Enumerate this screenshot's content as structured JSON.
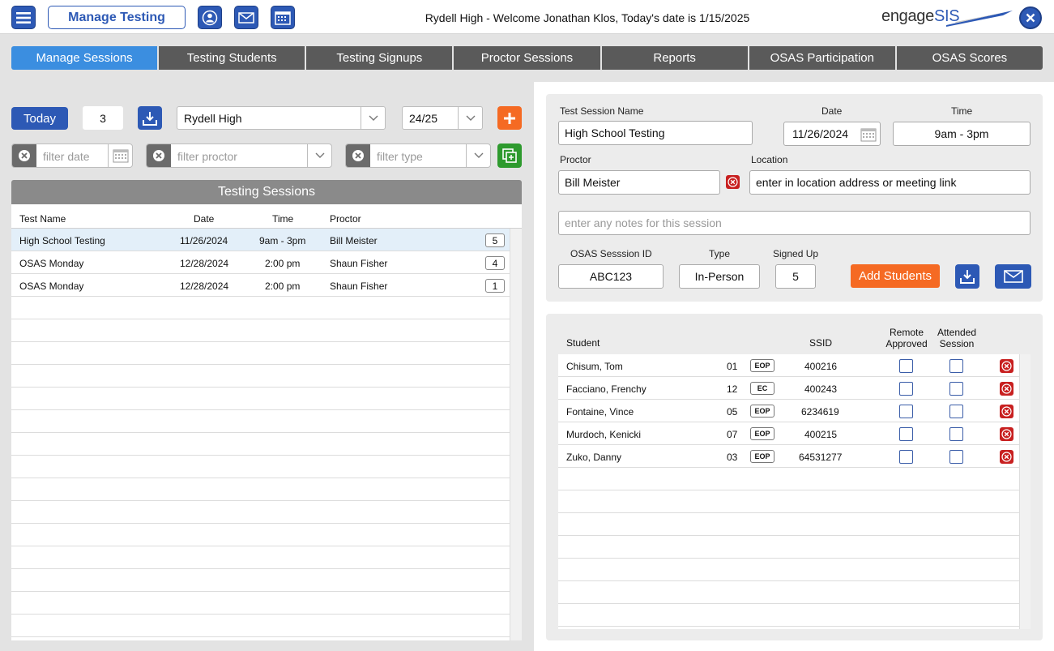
{
  "header": {
    "app_title": "Manage Testing",
    "welcome": "Rydell High - Welcome Jonathan Klos, Today's date is 1/15/2025",
    "logo_main": "engage",
    "logo_accent": "SIS"
  },
  "tabs": [
    {
      "label": "Manage Sessions",
      "active": true
    },
    {
      "label": "Testing Students"
    },
    {
      "label": "Testing Signups"
    },
    {
      "label": "Proctor Sessions"
    },
    {
      "label": "Reports"
    },
    {
      "label": "OSAS Participation"
    },
    {
      "label": "OSAS Scores"
    }
  ],
  "controls": {
    "today_label": "Today",
    "count": "3",
    "school": "Rydell High",
    "year": "24/25",
    "filter_date_placeholder": "filter date",
    "filter_proctor_placeholder": "filter proctor",
    "filter_type_placeholder": "filter type"
  },
  "sessions": {
    "title": "Testing Sessions",
    "columns": {
      "name": "Test Name",
      "date": "Date",
      "time": "Time",
      "proctor": "Proctor"
    },
    "rows": [
      {
        "name": "High School Testing",
        "date": "11/26/2024",
        "time": "9am - 3pm",
        "proctor": "Bill Meister",
        "count": "5"
      },
      {
        "name": "OSAS Monday",
        "date": "12/28/2024",
        "time": "2:00 pm",
        "proctor": "Shaun Fisher",
        "count": "4"
      },
      {
        "name": "OSAS Monday",
        "date": "12/28/2024",
        "time": "2:00 pm",
        "proctor": "Shaun Fisher",
        "count": "1"
      }
    ]
  },
  "detail": {
    "name_label": "Test Session Name",
    "name_value": "High School Testing",
    "date_label": "Date",
    "date_value": "11/26/2024",
    "time_label": "Time",
    "time_value": "9am - 3pm",
    "proctor_label": "Proctor",
    "proctor_value": "Bill Meister",
    "location_label": "Location",
    "location_value": "enter in location address or meeting link",
    "notes_placeholder": "enter any notes for this session",
    "osas_id_label": "OSAS Sesssion ID",
    "osas_id_value": "ABC123",
    "type_label": "Type",
    "type_value": "In-Person",
    "signed_up_label": "Signed Up",
    "signed_up_value": "5",
    "add_students_label": "Add Students"
  },
  "students": {
    "columns": {
      "student": "Student",
      "ssid": "SSID",
      "remote_1": "Remote",
      "remote_2": "Approved",
      "attended_1": "Attended",
      "attended_2": "Session"
    },
    "rows": [
      {
        "name": "Chisum, Tom",
        "grade": "01",
        "badge": "EOP",
        "ssid": "400216"
      },
      {
        "name": "Facciano, Frenchy",
        "grade": "12",
        "badge": "EC",
        "ssid": "400243"
      },
      {
        "name": "Fontaine, Vince",
        "grade": "05",
        "badge": "EOP",
        "ssid": "6234619"
      },
      {
        "name": "Murdoch, Kenicki",
        "grade": "07",
        "badge": "EOP",
        "ssid": "400215"
      },
      {
        "name": "Zuko, Danny",
        "grade": "03",
        "badge": "EOP",
        "ssid": "64531277"
      }
    ]
  },
  "colors": {
    "primary": "#2d59b5",
    "tab_active": "#3b8ee0",
    "tab": "#5a5a5a",
    "orange": "#f56a23",
    "green": "#2e9a2e",
    "danger": "#c82020"
  }
}
